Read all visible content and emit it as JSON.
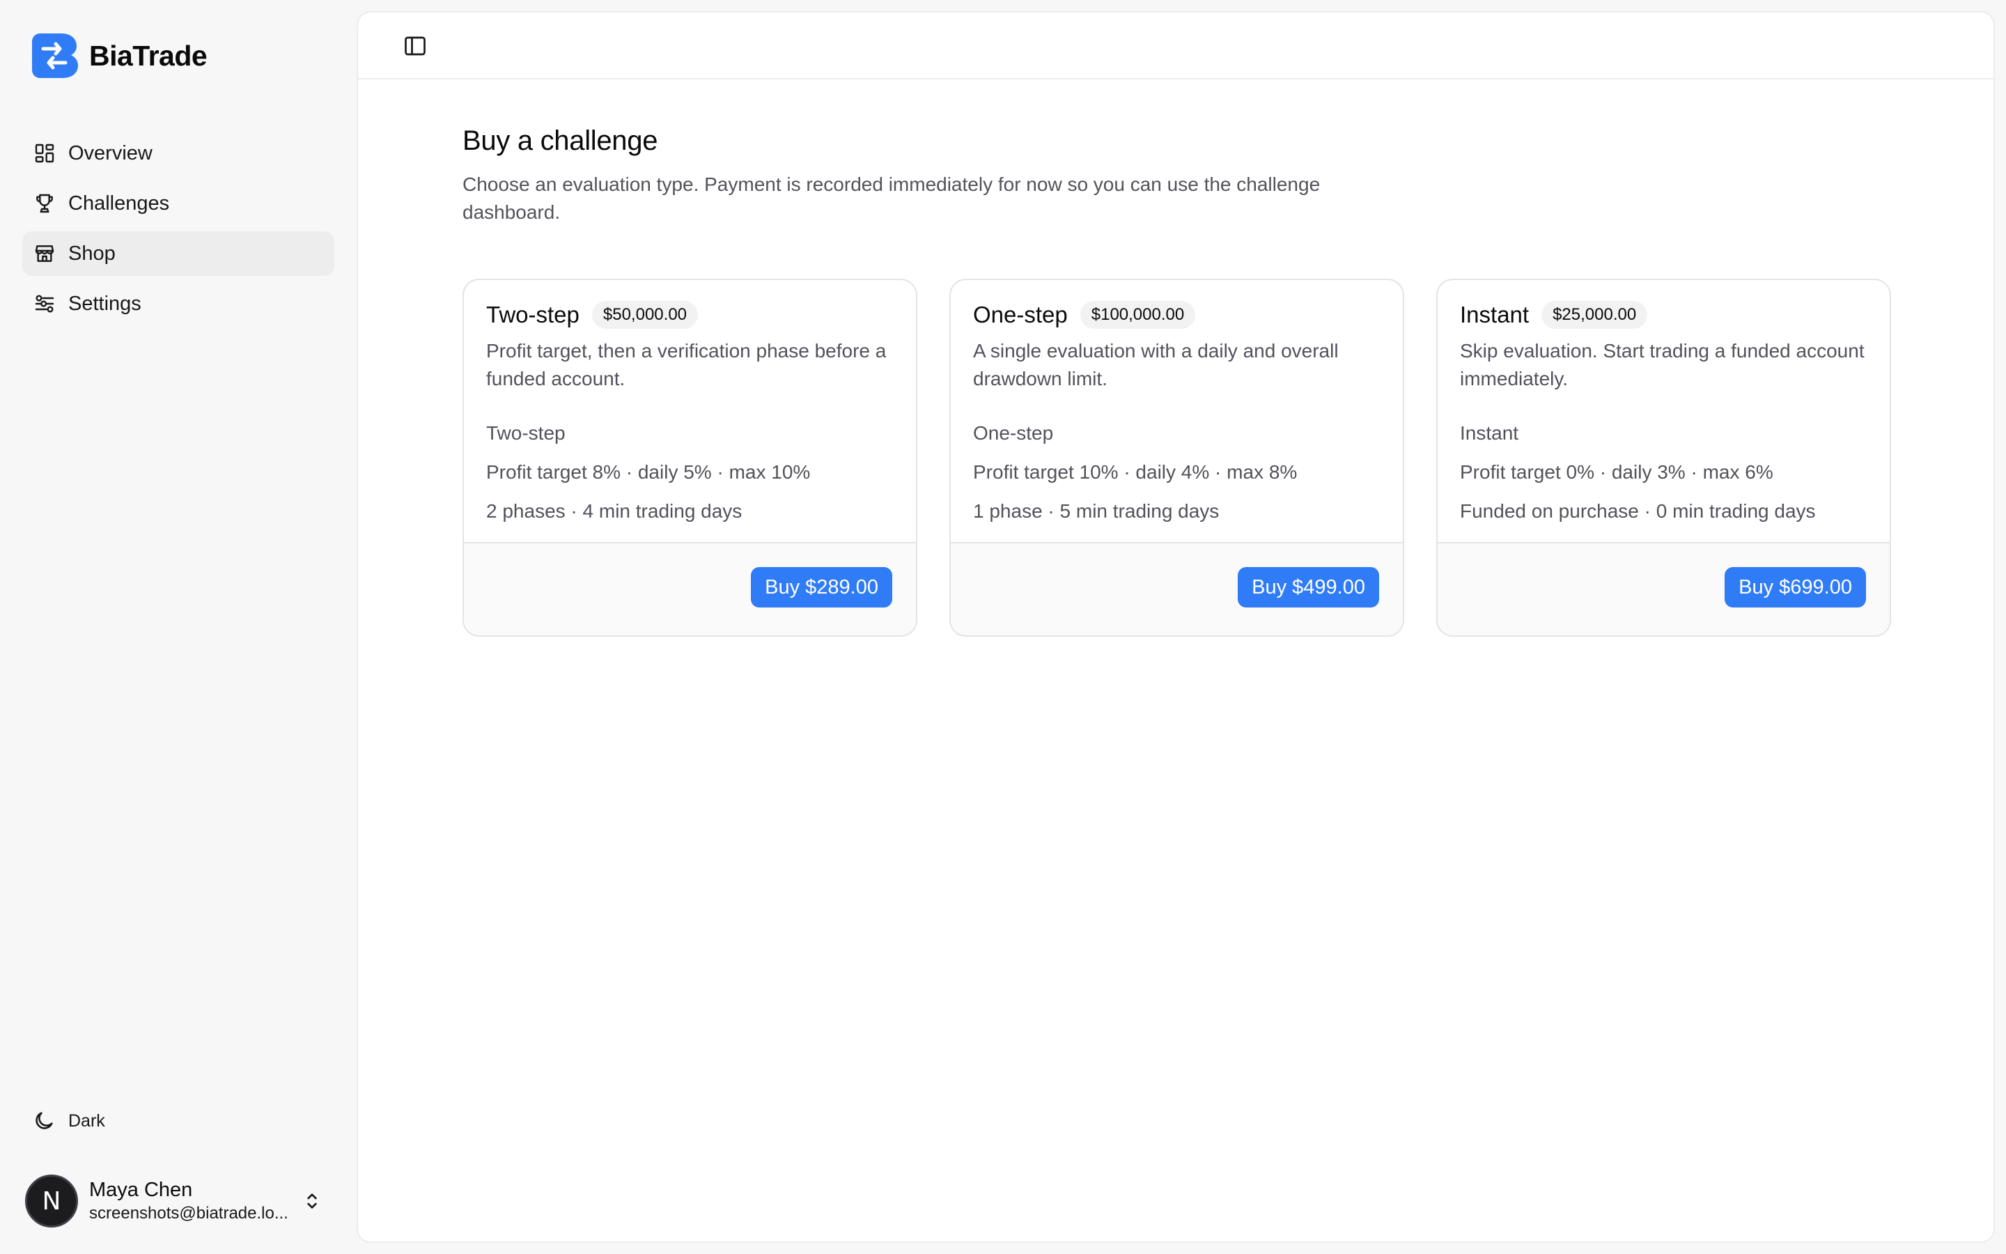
{
  "brand": {
    "name": "BiaTrade",
    "accent": "#2f7cf6"
  },
  "sidebar": {
    "items": [
      {
        "label": "Overview",
        "icon": "grid-icon",
        "active": false
      },
      {
        "label": "Challenges",
        "icon": "trophy-icon",
        "active": false
      },
      {
        "label": "Shop",
        "icon": "store-icon",
        "active": true
      },
      {
        "label": "Settings",
        "icon": "sliders-icon",
        "active": false
      }
    ],
    "theme_label": "Dark",
    "user": {
      "avatar_letter": "N",
      "name": "Maya Chen",
      "email": "screenshots@biatrade.lo..."
    }
  },
  "page": {
    "title": "Buy a challenge",
    "subtitle": "Choose an evaluation type. Payment is recorded immediately for now so you can use the challenge dashboard."
  },
  "cards": [
    {
      "title": "Two-step",
      "badge": "$50,000.00",
      "description": "Profit target, then a verification phase before a funded account.",
      "lines": [
        "Two-step",
        "Profit target 8% · daily 5% · max 10%",
        "2 phases · 4 min trading days"
      ],
      "button": "Buy $289.00"
    },
    {
      "title": "One-step",
      "badge": "$100,000.00",
      "description": "A single evaluation with a daily and overall drawdown limit.",
      "lines": [
        "One-step",
        "Profit target 10% · daily 4% · max 8%",
        "1 phase · 5 min trading days"
      ],
      "button": "Buy $499.00"
    },
    {
      "title": "Instant",
      "badge": "$25,000.00",
      "description": "Skip evaluation. Start trading a funded account immediately.",
      "lines": [
        "Instant",
        "Profit target 0% · daily 3% · max 6%",
        "Funded on purchase · 0 min trading days"
      ],
      "button": "Buy $699.00"
    }
  ]
}
